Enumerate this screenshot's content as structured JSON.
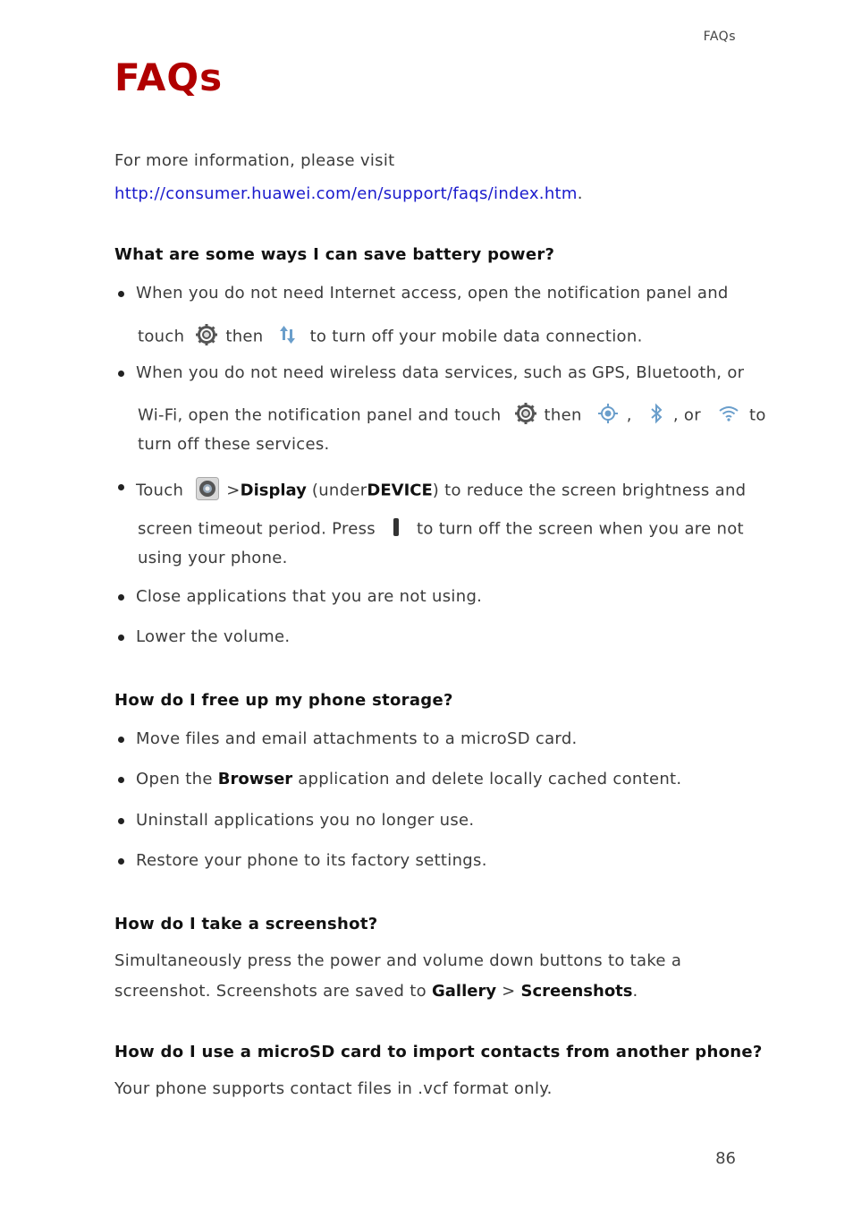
{
  "header": {
    "running_title": "FAQs"
  },
  "title": "FAQs",
  "intro": {
    "text": "For more information, please visit",
    "link": "http://consumer.huawei.com/en/support/faqs/index.htm",
    "link_suffix": "."
  },
  "battery": {
    "question": "What are some ways I can save battery power?",
    "b1_line1": "When you do not need Internet access, open the notification panel and",
    "b1_touch": "touch",
    "b1_then": "then",
    "b1_rest": "to turn off your mobile data connection.",
    "b2_line1": "When you do not need wireless data services, such as GPS, Bluetooth, or",
    "b2_pre": "Wi-Fi, open the notification panel and touch",
    "b2_then": "then",
    "b2_comma": ",",
    "b2_or": ", or",
    "b2_to": "to",
    "b2_line3": "turn off these services.",
    "b3_touch": "Touch",
    "b3_gt": ">",
    "b3_display": "Display",
    "b3_under": "(under",
    "b3_device": "DEVICE",
    "b3_rest": ") to reduce the screen brightness and",
    "b3_line2_pre": "screen timeout period. Press",
    "b3_line2_post": "to turn off the screen when you are not",
    "b3_line3": "using your phone.",
    "b4": "Close applications that you are not using.",
    "b5": "Lower the volume."
  },
  "storage": {
    "question": "How do I free up my phone storage?",
    "b1": "Move files and email attachments to a microSD card.",
    "b2_pre": "Open the",
    "b2_bold": "Browser",
    "b2_post": "application and delete locally cached content.",
    "b3": "Uninstall applications you no longer use.",
    "b4": "Restore your phone to its factory settings."
  },
  "screenshot": {
    "question": "How do I take a screenshot?",
    "line1": "Simultaneously press the power and volume down buttons to take a",
    "line2_pre": "screenshot. Screenshots are saved to",
    "gallery": "Gallery",
    "gt": ">",
    "screenshots": "Screenshots",
    "period": "."
  },
  "microsd": {
    "question": "How do I use a microSD card to import contacts from another phone?",
    "answer": "Your phone supports contact files in .vcf format only."
  },
  "icons": {
    "gear": "gear-icon",
    "data": "mobile-data-icon",
    "gps": "gps-icon",
    "bluetooth": "bluetooth-icon",
    "wifi": "wifi-icon",
    "settings": "settings-app-icon",
    "power": "power-button-icon"
  },
  "colors": {
    "title": "#b00000",
    "link": "#1a1acc",
    "icon_blue": "#6a9ecb"
  },
  "footer": {
    "page_number": "86"
  }
}
